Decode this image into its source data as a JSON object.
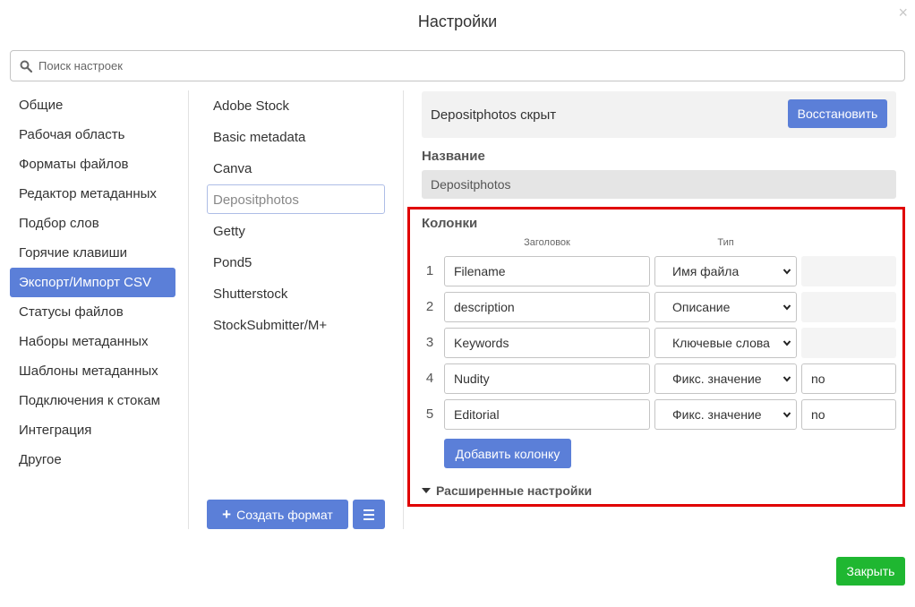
{
  "dialog": {
    "title": "Настройки",
    "close_icon": "×"
  },
  "search": {
    "placeholder": "Поиск настроек"
  },
  "sidebar": {
    "items": [
      {
        "label": "Общие",
        "active": false
      },
      {
        "label": "Рабочая область",
        "active": false
      },
      {
        "label": "Форматы файлов",
        "active": false
      },
      {
        "label": "Редактор метаданных",
        "active": false
      },
      {
        "label": "Подбор слов",
        "active": false
      },
      {
        "label": "Горячие клавиши",
        "active": false
      },
      {
        "label": "Экспорт/Импорт CSV",
        "active": true
      },
      {
        "label": "Статусы файлов",
        "active": false
      },
      {
        "label": "Наборы метаданных",
        "active": false
      },
      {
        "label": "Шаблоны метаданных",
        "active": false
      },
      {
        "label": "Подключения к стокам",
        "active": false
      },
      {
        "label": "Интеграция",
        "active": false
      },
      {
        "label": "Другое",
        "active": false
      }
    ]
  },
  "formats": {
    "items": [
      {
        "label": "Adobe Stock",
        "selected": false
      },
      {
        "label": "Basic metadata",
        "selected": false
      },
      {
        "label": "Canva",
        "selected": false
      },
      {
        "label": "Depositphotos",
        "selected": true
      },
      {
        "label": "Getty",
        "selected": false
      },
      {
        "label": "Pond5",
        "selected": false
      },
      {
        "label": "Shutterstock",
        "selected": false
      },
      {
        "label": "StockSubmitter/M+",
        "selected": false
      }
    ],
    "create_label": "Создать формат",
    "create_icon": "plus-icon",
    "menu_icon": "hamburger-menu-icon"
  },
  "detail": {
    "banner_text": "Depositphotos скрыт",
    "restore_label": "Восстановить",
    "name_label": "Название",
    "name_value": "Depositphotos",
    "columns_title": "Колонки",
    "header_col_label": "Заголовок",
    "type_col_label": "Тип",
    "rows": [
      {
        "num": "1",
        "header": "Filename",
        "type": "Имя файла",
        "value": ""
      },
      {
        "num": "2",
        "header": "description",
        "type": "Описание",
        "value": ""
      },
      {
        "num": "3",
        "header": "Keywords",
        "type": "Ключевые слова",
        "value": ""
      },
      {
        "num": "4",
        "header": "Nudity",
        "type": "Фикс. значение",
        "value": "no"
      },
      {
        "num": "5",
        "header": "Editorial",
        "type": "Фикс. значение",
        "value": "no"
      }
    ],
    "add_column_label": "Добавить колонку",
    "advanced_label": "Расширенные настройки"
  },
  "footer": {
    "close_label": "Закрыть"
  },
  "colors": {
    "accent": "#5b7fd8",
    "success": "#1fb731",
    "highlight_border": "#e00000"
  }
}
